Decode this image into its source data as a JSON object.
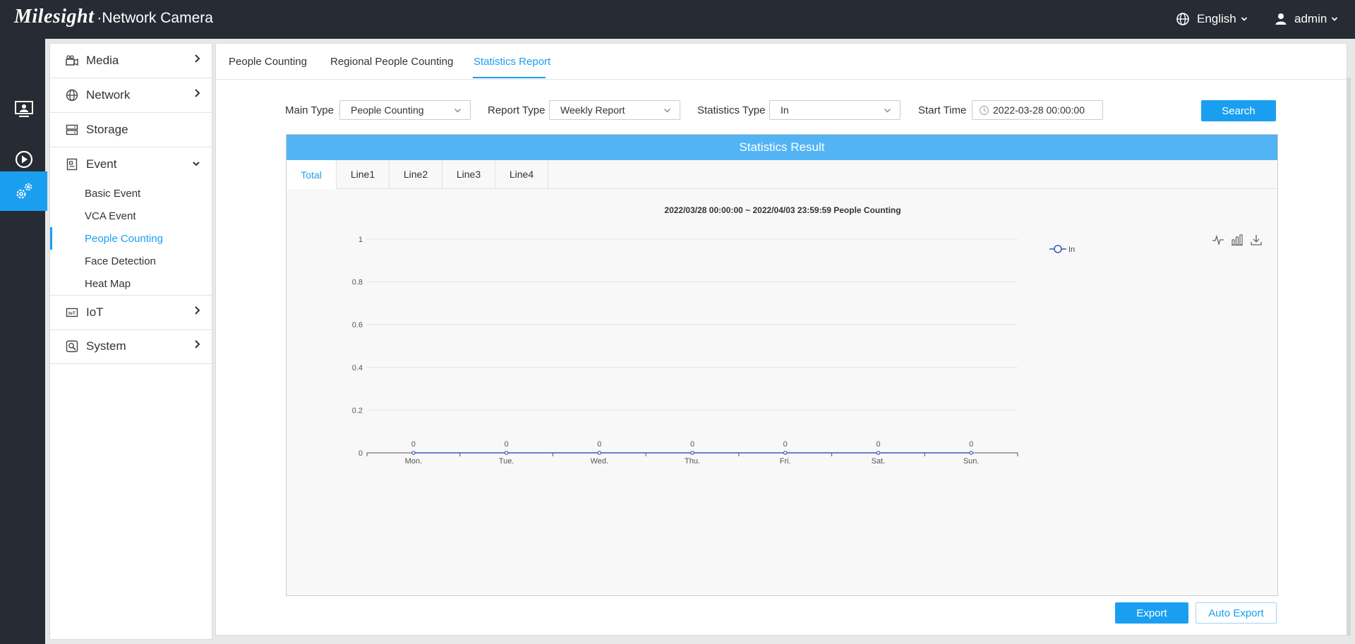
{
  "topbar": {
    "logo": "Milesight",
    "product": "·Network Camera",
    "language": "English",
    "user": "admin"
  },
  "rail": [
    {
      "icon": "live-view-icon"
    },
    {
      "icon": "playback-icon"
    },
    {
      "icon": "settings-icon",
      "active": true
    }
  ],
  "sidebar": {
    "menus": [
      {
        "label": "Media",
        "icon": "camera-icon"
      },
      {
        "label": "Network",
        "icon": "globe-icon"
      },
      {
        "label": "Storage",
        "icon": "storage-icon"
      },
      {
        "label": "Event",
        "icon": "event-icon",
        "expanded": true
      },
      {
        "label": "IoT",
        "icon": "iot-icon"
      },
      {
        "label": "System",
        "icon": "system-icon"
      }
    ],
    "event_items": [
      "Basic Event",
      "VCA Event",
      "People Counting",
      "Face Detection",
      "Heat Map"
    ],
    "active_item": "People Counting"
  },
  "tabs": [
    "People Counting",
    "Regional People Counting",
    "Statistics Report"
  ],
  "active_tab": "Statistics Report",
  "filters": {
    "main_type_label": "Main Type",
    "main_type": "People Counting",
    "report_type_label": "Report Type",
    "report_type": "Weekly Report",
    "stat_type_label": "Statistics Type",
    "stat_type": "In",
    "start_time_label": "Start Time",
    "start_time": "2022-03-28 00:00:00",
    "search": "Search"
  },
  "result": {
    "title": "Statistics Result",
    "tabs": [
      "Total",
      "Line1",
      "Line2",
      "Line3",
      "Line4"
    ],
    "active_tab": "Total"
  },
  "chart_data": {
    "type": "line",
    "title": "2022/03/28 00:00:00  ~  2022/04/03 23:59:59 People Counting",
    "categories": [
      "Mon.",
      "Tue.",
      "Wed.",
      "Thu.",
      "Fri.",
      "Sat.",
      "Sun."
    ],
    "series": [
      {
        "name": "In",
        "values": [
          0,
          0,
          0,
          0,
          0,
          0,
          0
        ],
        "color": "#3a56b8"
      }
    ],
    "ylim": [
      0,
      1
    ],
    "yticks": [
      "0",
      "0.2",
      "0.4",
      "0.6",
      "0.8",
      "1"
    ],
    "grid": true,
    "legend": "top-right"
  },
  "buttons": {
    "export": "Export",
    "auto_export": "Auto Export"
  },
  "colors": {
    "accent": "#1a9ff0",
    "header": "#52b4f4",
    "topbar": "#272b33"
  }
}
